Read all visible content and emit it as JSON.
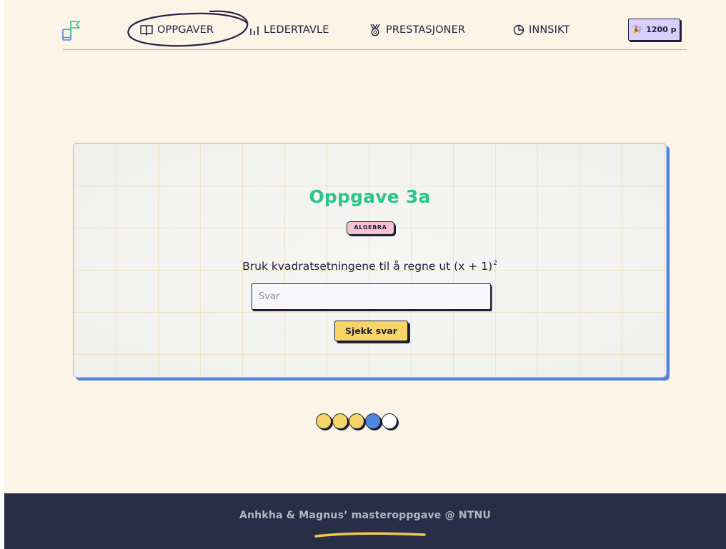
{
  "nav": {
    "items": [
      {
        "label": "OPPGAVER",
        "icon": "book-open-icon"
      },
      {
        "label": "LEDERTAVLE",
        "icon": "bar-chart-icon"
      },
      {
        "label": "PRESTASJONER",
        "icon": "medal-icon"
      },
      {
        "label": "INNSIKT",
        "icon": "pie-chart-icon"
      }
    ],
    "active": "OPPGAVER",
    "logo_icon": "book-flag-logo-icon"
  },
  "points": {
    "icon": "party-popper-icon",
    "label": "1200 p"
  },
  "task": {
    "title": "Oppgave 3a",
    "tag": "ALGEBRA",
    "question": "Bruk kvadratsetningene til å regne ut (x + 1)",
    "exponent": "2",
    "input_placeholder": "Svar",
    "input_value": "",
    "check_label": "Sjekk svar"
  },
  "progress": {
    "dots": [
      {
        "state": "done",
        "color": "#f7d467"
      },
      {
        "state": "done",
        "color": "#f7d467"
      },
      {
        "state": "done",
        "color": "#f7d467"
      },
      {
        "state": "current",
        "color": "#4f86e0"
      },
      {
        "state": "todo",
        "color": "#ffffff"
      }
    ]
  },
  "footer": {
    "text": "Anhkha & Magnus’ masteroppgave @ NTNU"
  },
  "colors": {
    "background": "#fcf4e6",
    "title_green": "#2bc48a",
    "accent_blue": "#4f86e0",
    "button_yellow": "#f7d467",
    "tag_pink": "#f7c1cf",
    "badge_purple": "#d8d0fb",
    "footer_navy": "#282e48",
    "ink": "#1f1f3a"
  }
}
